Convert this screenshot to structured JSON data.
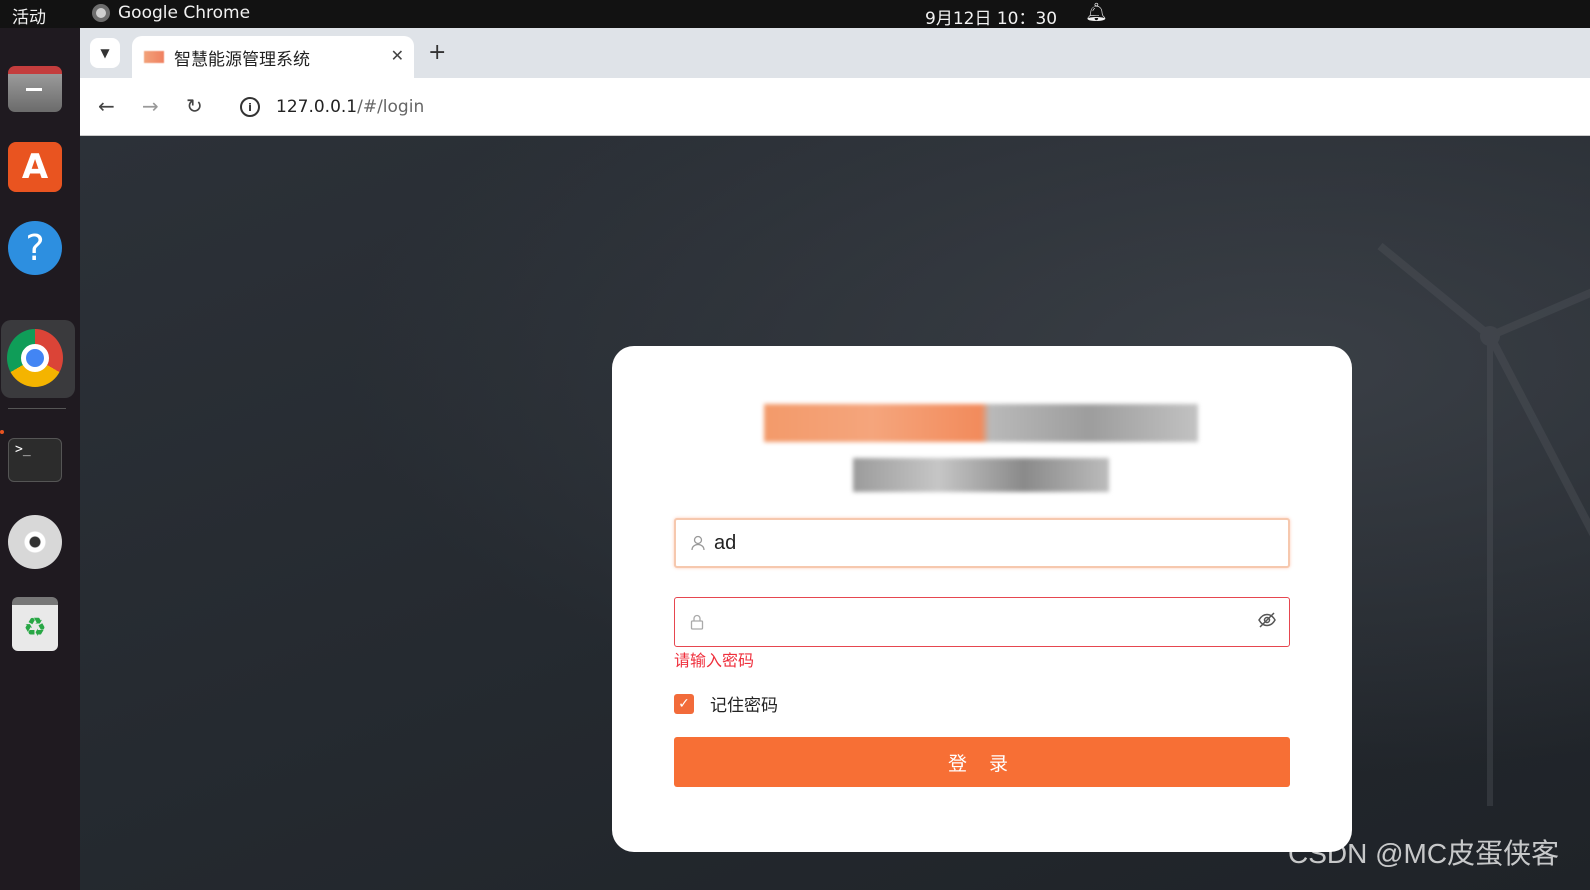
{
  "system": {
    "activities": "活动",
    "app_name": "Google Chrome",
    "clock": "9月12日  10：30"
  },
  "dock": {
    "items": [
      "files",
      "app-store",
      "help",
      "google-chrome",
      "terminal",
      "dvd",
      "trash"
    ]
  },
  "browser": {
    "tab_title": "智慧能源管理系统",
    "url_host": "127.0.0.1",
    "url_path": "/#/login"
  },
  "login": {
    "username_value": "ad",
    "password_value": "",
    "password_error": "请输入密码",
    "remember_label": "记住密码",
    "remember_checked": true,
    "submit_label": "登 录"
  },
  "watermark": "CSDN @MC皮蛋侠客",
  "colors": {
    "accent": "#f76f35",
    "error": "#ef2f3c"
  }
}
